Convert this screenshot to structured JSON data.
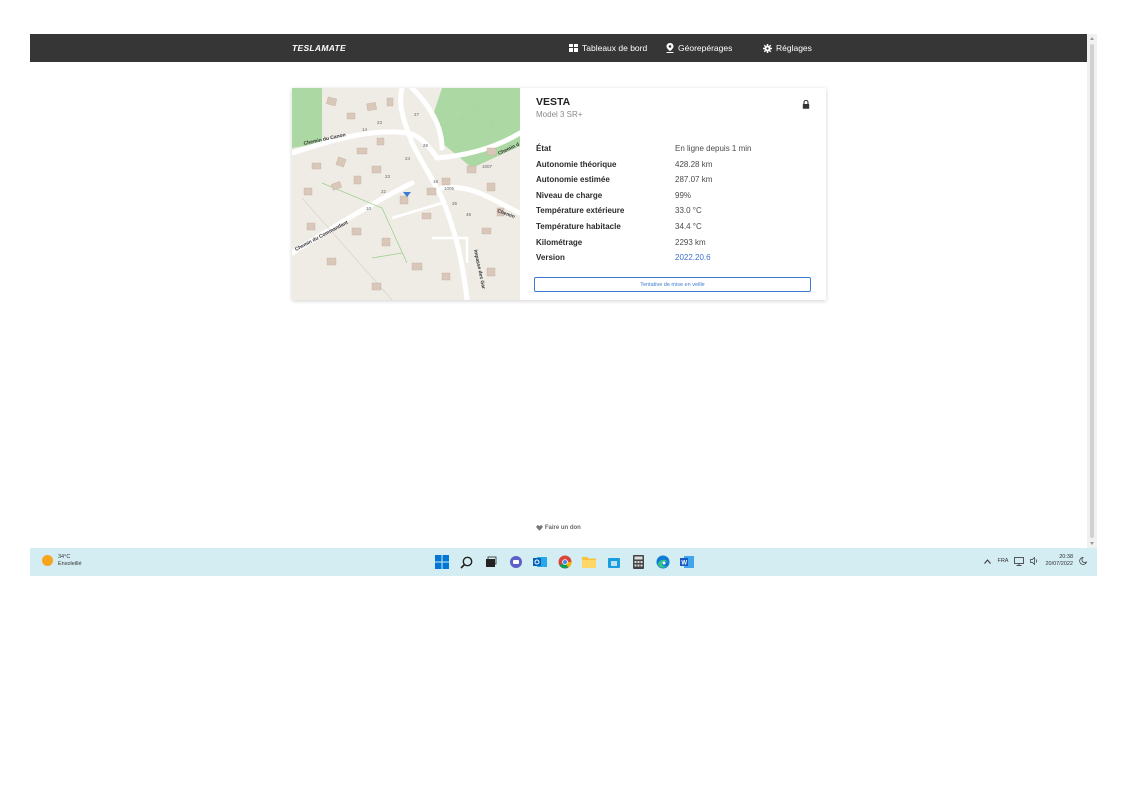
{
  "navbar": {
    "brand": "TESLAMATE",
    "items": [
      {
        "label": "Tableaux de bord",
        "icon": "dashboard-icon"
      },
      {
        "label": "Géorepérages",
        "icon": "map-pin-icon"
      },
      {
        "label": "Réglages",
        "icon": "gear-icon"
      }
    ]
  },
  "car": {
    "name": "VESTA",
    "model": "Model 3 SR+",
    "locked_icon": "lock-icon",
    "rows": [
      {
        "label": "État",
        "value": "En ligne depuis 1 min"
      },
      {
        "label": "Autonomie théorique",
        "value": "428.28 km"
      },
      {
        "label": "Autonomie estimée",
        "value": "287.07 km"
      },
      {
        "label": "Niveau de charge",
        "value": "99%"
      },
      {
        "label": "Température extérieure",
        "value": "33.0 °C"
      },
      {
        "label": "Température habitacle",
        "value": "34.4 °C"
      },
      {
        "label": "Kilométrage",
        "value": "2293 km"
      },
      {
        "label": "Version",
        "value": "2022.20.6"
      }
    ],
    "sleep_button": "Tentative de mise en veille"
  },
  "map": {
    "streets": [
      "Chemin du Canon",
      "Chemin du Commandant",
      "Chemin d",
      "Chemin",
      "Impasse des Gar"
    ],
    "house_numbers": [
      "27",
      "23",
      "14",
      "24",
      "28",
      "22",
      "23",
      "18",
      "1005",
      "1007",
      "25",
      "48",
      "10"
    ]
  },
  "footer": {
    "donate": "Faire un don",
    "donate_icon": "heart-icon"
  },
  "taskbar": {
    "weather_temp": "34°C",
    "weather_desc": "Ensoleillé",
    "language": "FRA",
    "time": "20:38",
    "date": "20/07/2022",
    "apps": [
      "windows-start-icon",
      "search-icon",
      "task-view-icon",
      "teams-chat-icon",
      "outlook-icon",
      "chrome-icon",
      "file-explorer-icon",
      "store-icon",
      "calculator-icon",
      "edge-icon",
      "word-icon"
    ]
  },
  "colors": {
    "navbar": "#363636",
    "accent": "#3e7bd1",
    "taskbar": "#d3edf2"
  }
}
